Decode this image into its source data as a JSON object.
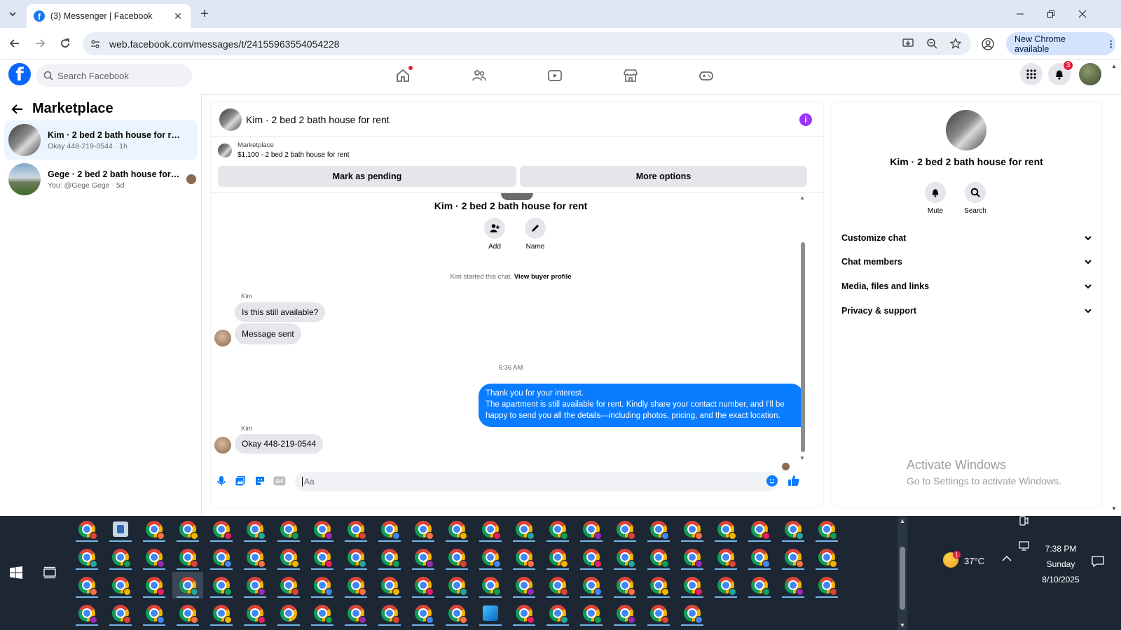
{
  "browser": {
    "tab_title": "(3) Messenger | Facebook",
    "url": "web.facebook.com/messages/t/24155963554054228",
    "update_label": "New Chrome available"
  },
  "fb_header": {
    "search_placeholder": "Search Facebook",
    "notification_count": "3"
  },
  "left_panel": {
    "title": "Marketplace",
    "conversations": [
      {
        "name": "Kim · 2 bed 2 bath house for rent",
        "preview": "Okay 448-219-0544 · 1h",
        "active": true
      },
      {
        "name": "Gege · 2 bed 2 bath house for re...",
        "preview": "You: @Gege Gege · 5d",
        "active": false
      }
    ]
  },
  "chat": {
    "title": "Kim · 2 bed 2 bath house for rent",
    "marketplace_label": "Marketplace",
    "listing": "$1,100 - 2 bed 2 bath house for rent",
    "btn_pending": "Mark as pending",
    "btn_more": "More options",
    "intro_name": "Kim · 2 bed 2 bath house for rent",
    "action_add": "Add",
    "action_name": "Name",
    "started_text": "Kim started this chat.",
    "started_link": "View buyer profile",
    "sender_1": "Kim",
    "msg_1": "Is this still available?",
    "msg_2": "Message sent",
    "timestamp": "6:36 AM",
    "out_line1": "Thank you for your interest.",
    "out_line2": "The apartment is still available for rent. Kindly share your contact number, and I'll be happy to send you all the details—including photos, pricing, and the exact location.",
    "sender_2": "Kim",
    "msg_3": "Okay 448-219-0544",
    "composer_placeholder": "Aa"
  },
  "right_panel": {
    "name": "Kim · 2 bed 2 bath house for rent",
    "mute_label": "Mute",
    "search_label": "Search",
    "sections": [
      "Customize chat",
      "Chat members",
      "Media, files and links",
      "Privacy & support"
    ],
    "watermark_title": "Activate Windows",
    "watermark_sub": "Go to Settings to activate Windows."
  },
  "taskbar": {
    "temperature": "37°C",
    "weather_badge": "1",
    "time": "7:38 PM",
    "day": "Sunday",
    "date": "8/10/2025"
  },
  "colors": {
    "accent": "#0a7cff",
    "fb_blue": "#0866ff",
    "info_purple": "#a033ff",
    "taskbar_bg": "#1c2733"
  }
}
